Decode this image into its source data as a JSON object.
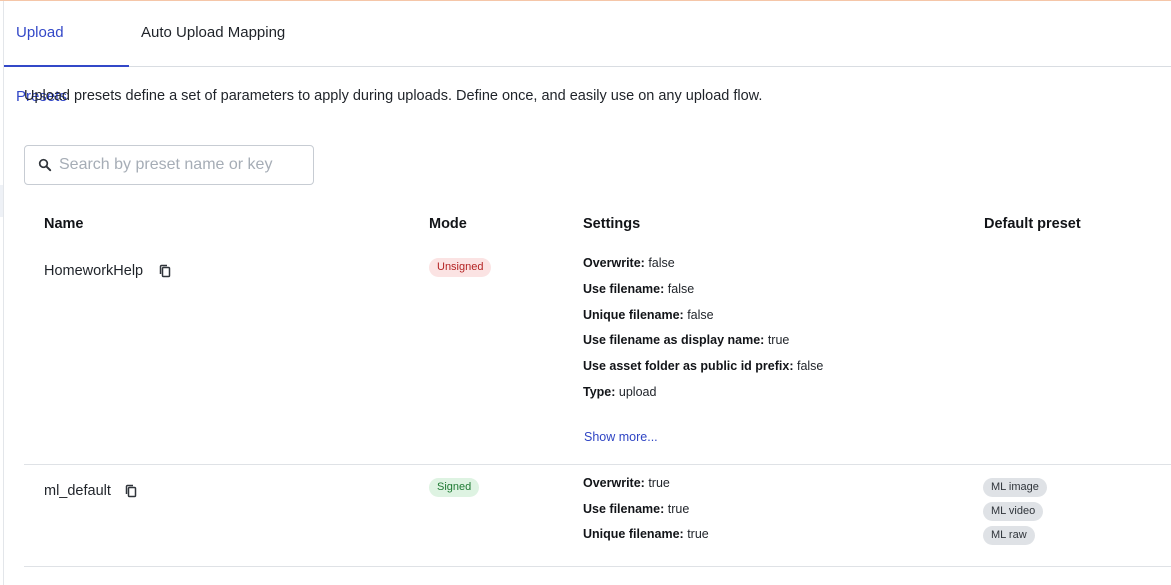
{
  "tabs": [
    {
      "label": "Upload Presets",
      "active": true
    },
    {
      "label": "Auto Upload Mapping",
      "active": false
    }
  ],
  "description": "Upload presets define a set of parameters to apply during uploads. Define once, and easily use on any upload flow.",
  "search": {
    "placeholder": "Search by preset name or key",
    "value": ""
  },
  "table": {
    "headers": {
      "name": "Name",
      "mode": "Mode",
      "settings": "Settings",
      "default": "Default preset"
    },
    "rows": [
      {
        "name": "HomeworkHelp",
        "mode": "Unsigned",
        "settings": [
          {
            "label": "Overwrite:",
            "value": "false"
          },
          {
            "label": "Use filename:",
            "value": "false"
          },
          {
            "label": "Unique filename:",
            "value": "false"
          },
          {
            "label": "Use filename as display name:",
            "value": "true"
          },
          {
            "label": "Use asset folder as public id prefix:",
            "value": "false"
          },
          {
            "label": "Type:",
            "value": "upload"
          }
        ],
        "show_more": "Show more...",
        "default_presets": []
      },
      {
        "name": "ml_default",
        "mode": "Signed",
        "settings": [
          {
            "label": "Overwrite:",
            "value": "true"
          },
          {
            "label": "Use filename:",
            "value": "true"
          },
          {
            "label": "Unique filename:",
            "value": "true"
          }
        ],
        "default_presets": [
          "ML image",
          "ML video",
          "ML raw"
        ]
      }
    ]
  },
  "colors": {
    "accent": "#3348c8",
    "unsigned_bg": "#fbe3e3",
    "unsigned_text": "#b42323",
    "signed_bg": "#def3e2",
    "signed_text": "#1f7a33"
  }
}
